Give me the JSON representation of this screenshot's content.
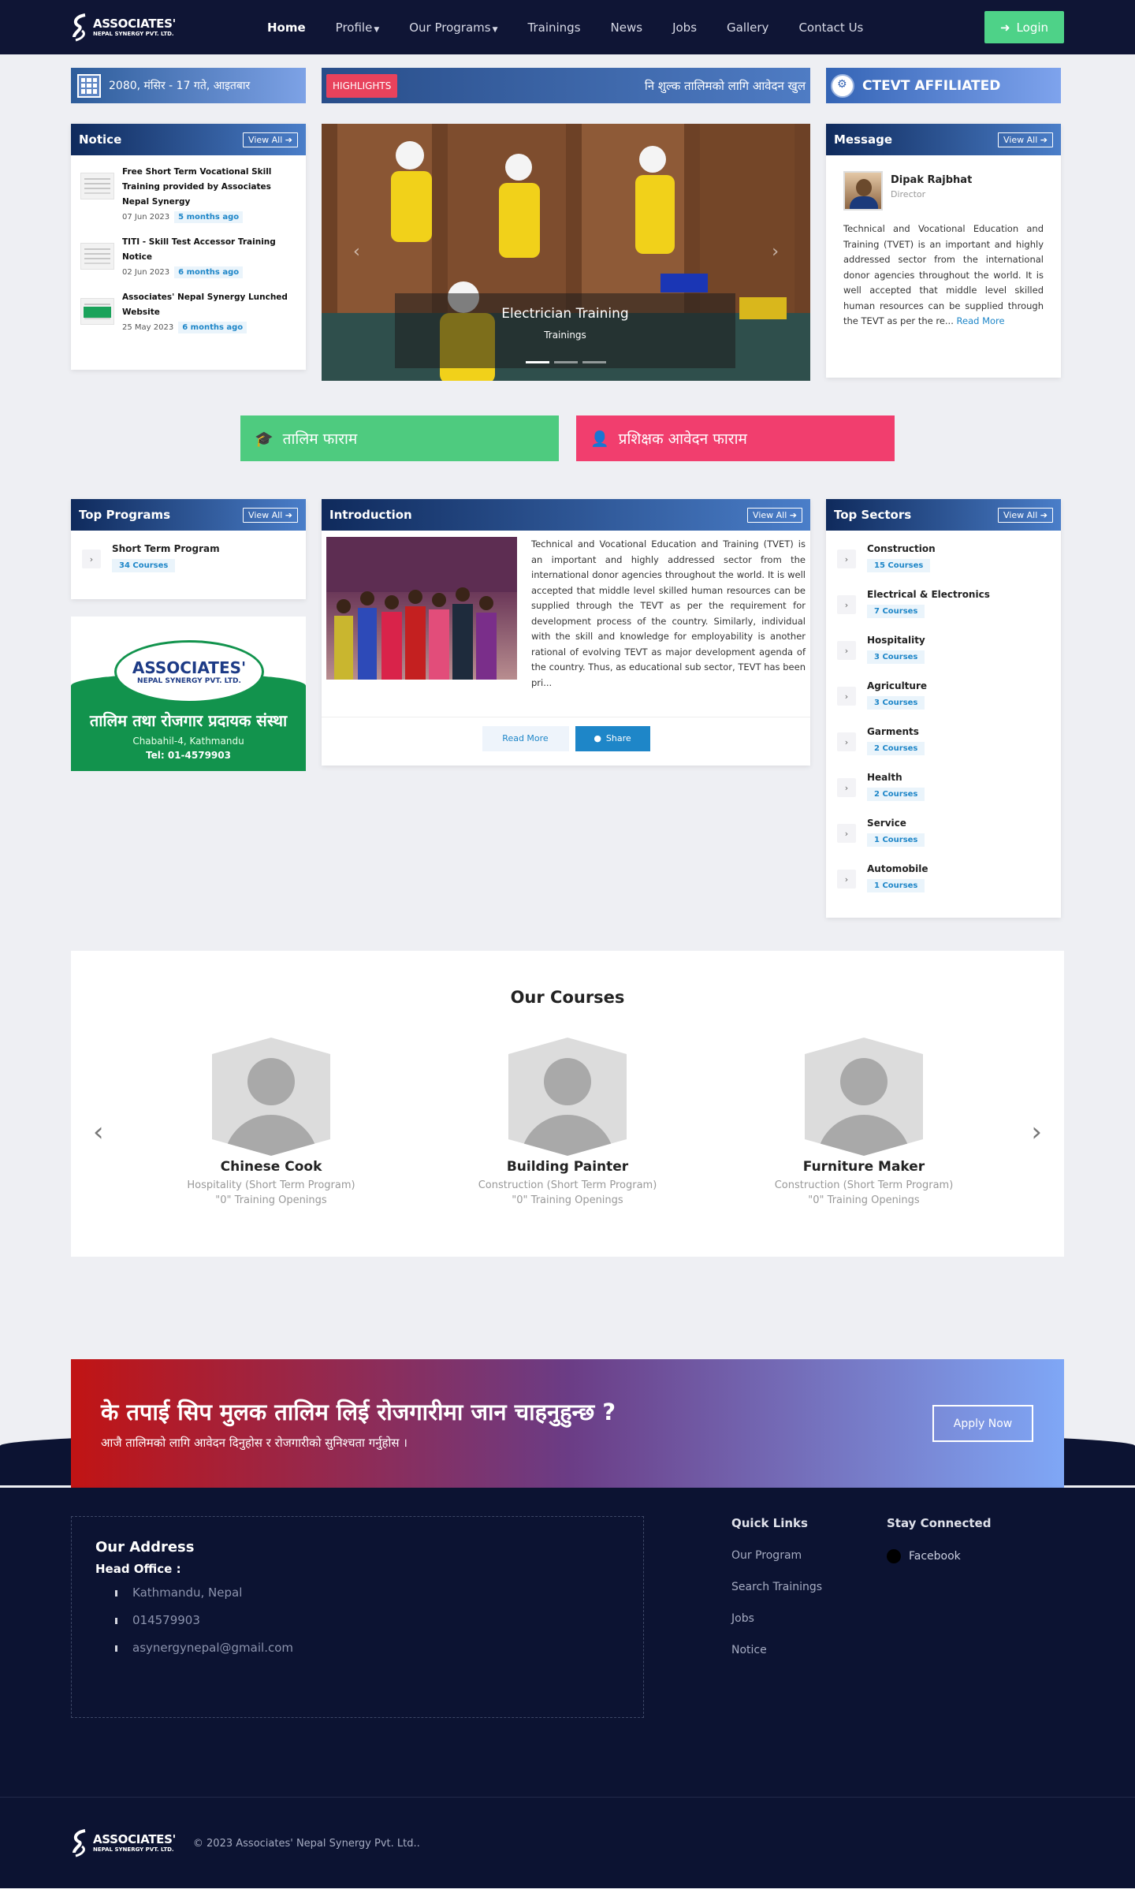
{
  "brand": {
    "name": "ASSOCIATES'",
    "tagline": "NEPAL SYNERGY PVT. LTD."
  },
  "nav": {
    "items": [
      {
        "label": "Home",
        "active": true,
        "dropdown": false
      },
      {
        "label": "Profile",
        "active": false,
        "dropdown": true
      },
      {
        "label": "Our Programs",
        "active": false,
        "dropdown": true
      },
      {
        "label": "Trainings",
        "active": false,
        "dropdown": false
      },
      {
        "label": "News",
        "active": false,
        "dropdown": false
      },
      {
        "label": "Jobs",
        "active": false,
        "dropdown": false
      },
      {
        "label": "Gallery",
        "active": false,
        "dropdown": false
      },
      {
        "label": "Contact Us",
        "active": false,
        "dropdown": false
      }
    ],
    "login": "Login"
  },
  "date": "2080, मंसिर - 17 गते, आइतबार",
  "highlights": {
    "tag": "HIGHLIGHTS",
    "text": "नि शुल्क तालिमको लागि आवेदन खुल"
  },
  "ctevt": "CTEVT AFFILIATED",
  "notice": {
    "title": "Notice",
    "view_all": "View All",
    "items": [
      {
        "title": "Free Short Term Vocational Skill Training provided by Associates Nepal Synergy",
        "date": "07 Jun 2023",
        "ago": "5 months ago"
      },
      {
        "title": "TITI - Skill Test Accessor Training Notice",
        "date": "02 Jun 2023",
        "ago": "6 months ago"
      },
      {
        "title": "Associates' Nepal Synergy Lunched Website",
        "date": "25 May 2023",
        "ago": "6 months ago"
      }
    ]
  },
  "slider": {
    "title": "Electrician Training",
    "subtitle": "Trainings"
  },
  "message": {
    "title": "Message",
    "view_all": "View All",
    "name": "Dipak Rajbhat",
    "role": "Director",
    "text": "Technical and Vocational Education and Training (TVET) is an important and highly addressed sector from the international donor agencies throughout the world. It is well accepted that middle level skilled human resources can be supplied through the TEVT as per the re...",
    "more": "Read More"
  },
  "forms": {
    "training": "तालिम फाराम",
    "trainer": "प्रशिक्षक आवेदन फाराम"
  },
  "top_programs": {
    "title": "Top Programs",
    "view_all": "View All",
    "items": [
      {
        "name": "Short Term Program",
        "count": "34 Courses"
      }
    ]
  },
  "ad": {
    "brand": "ASSOCIATES'",
    "tagline": "NEPAL SYNERGY PVT. LTD.",
    "line1": "तालिम तथा रोजगार प्रदायक संस्था",
    "line2": "Chabahil-4, Kathmandu",
    "line3": "Tel: 01-4579903"
  },
  "introduction": {
    "title": "Introduction",
    "view_all": "View All",
    "text": "Technical and Vocational Education and Training (TVET) is an important and highly addressed sector from the international donor agencies throughout the world. It is well accepted that middle level skilled human resources can be supplied through the TEVT as per the requirement for development process of the country. Similarly, individual with the skill and knowledge for employability is another rational of evolving TEVT as major development agenda of the country. Thus, as educational sub sector, TEVT has been pri...",
    "read_more": "Read More",
    "share": "Share"
  },
  "top_sectors": {
    "title": "Top Sectors",
    "view_all": "View All",
    "items": [
      {
        "name": "Construction",
        "count": "15 Courses"
      },
      {
        "name": "Electrical & Electronics",
        "count": "7 Courses"
      },
      {
        "name": "Hospitality",
        "count": "3 Courses"
      },
      {
        "name": "Agriculture",
        "count": "3 Courses"
      },
      {
        "name": "Garments",
        "count": "2 Courses"
      },
      {
        "name": "Health",
        "count": "2 Courses"
      },
      {
        "name": "Service",
        "count": "1 Courses"
      },
      {
        "name": "Automobile",
        "count": "1 Courses"
      }
    ]
  },
  "courses": {
    "title": "Our Courses",
    "items": [
      {
        "name": "Chinese Cook",
        "category": "Hospitality (Short Term Program)",
        "openings": "\"0\" Training Openings"
      },
      {
        "name": "Building Painter",
        "category": "Construction (Short Term Program)",
        "openings": "\"0\" Training Openings"
      },
      {
        "name": "Furniture Maker",
        "category": "Construction (Short Term Program)",
        "openings": "\"0\" Training Openings"
      }
    ]
  },
  "cta": {
    "heading": "के तपाई सिप मुलक तालिम लिई रोजगारीमा जान चाहनुहुन्छ ?",
    "sub": "आजै तालिमको लागि आवेदन दिनुहोस र रोजगारीको सुनिश्चता गर्नुहोस ।",
    "button": "Apply Now"
  },
  "footer": {
    "address_title": "Our Address",
    "head_office": "Head Office :",
    "address": [
      "Kathmandu, Nepal",
      "014579903",
      "asynergynepal@gmail.com"
    ],
    "quick_links_title": "Quick Links",
    "quick_links": [
      "Our Program",
      "Search Trainings",
      "Jobs",
      "Notice"
    ],
    "stay_title": "Stay Connected",
    "facebook": "Facebook",
    "copyright": "© 2023 Associates' Nepal Synergy Pvt. Ltd.."
  },
  "colors": {
    "navy": "#0f1535",
    "green": "#4ecb7f",
    "pink": "#f13e6e",
    "link": "#1e86c8"
  }
}
